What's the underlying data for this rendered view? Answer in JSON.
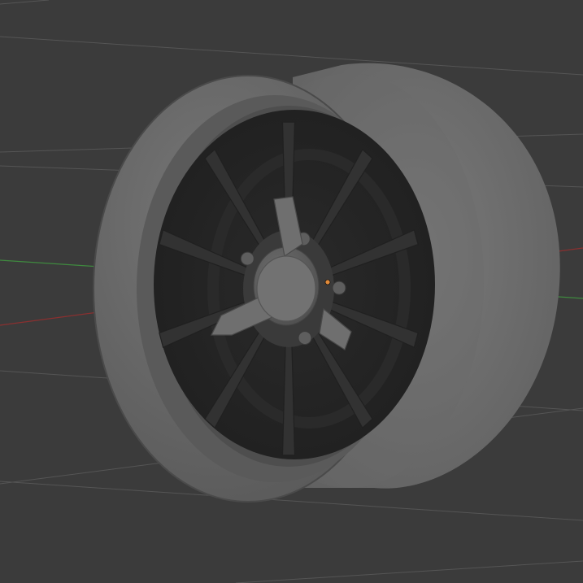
{
  "app": {
    "view": "3D Viewport",
    "shading": "solid"
  },
  "colors": {
    "background": "#3b3b3b",
    "grid_line": "#545454",
    "x_axis": "#8a3030",
    "y_axis": "#3f8a3f",
    "tire": "#707070",
    "rim_lip": "#6a6a6a",
    "rim_face": "#252525",
    "spokes": "#2f2f2f",
    "hub": "#5d5d5d",
    "origin_point": "#e08a3a"
  },
  "scene": {
    "object": "wheel",
    "spoke_count": 10,
    "lug_nut_count": 5,
    "spinner_wings": 3,
    "origin_visible": true
  }
}
